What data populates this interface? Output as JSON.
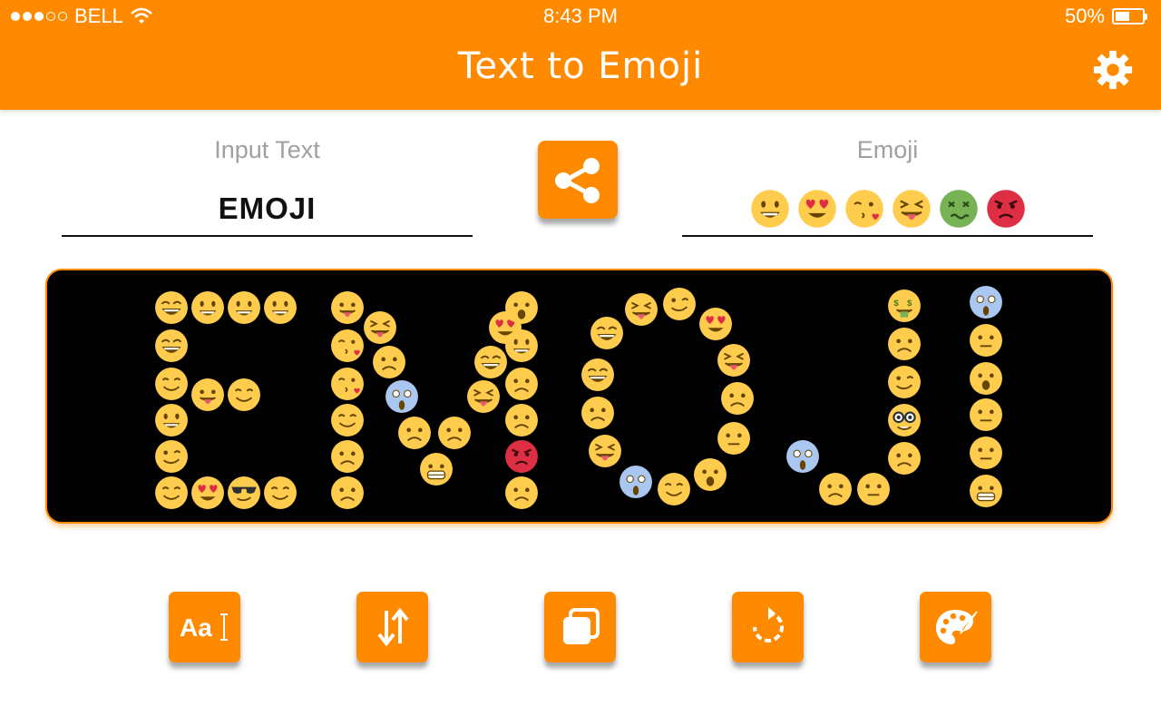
{
  "status_bar": {
    "carrier": "BELL",
    "time": "8:43 PM",
    "battery_percent": "50%",
    "battery_level": 0.5,
    "signal_bars": 3,
    "signal_total": 5
  },
  "nav": {
    "title": "Text to Emoji",
    "settings_icon": "gear-icon"
  },
  "input": {
    "label": "Input Text",
    "value": "EMOJI"
  },
  "emoji_field": {
    "label": "Emoji",
    "faces": [
      "grinning",
      "heart-eyes",
      "kissing-heart",
      "squinting-tongue",
      "nauseated",
      "pouting"
    ]
  },
  "share_icon": "share-icon",
  "toolbar": [
    {
      "name": "font-style-button",
      "icon": "text-format-icon"
    },
    {
      "name": "sort-button",
      "icon": "sort-arrows-icon"
    },
    {
      "name": "copy-button",
      "icon": "copy-icon"
    },
    {
      "name": "reset-button",
      "icon": "rotate-icon"
    },
    {
      "name": "palette-button",
      "icon": "palette-icon"
    }
  ],
  "colors": {
    "accent": "#ff8a00",
    "canvas_bg": "#000000",
    "emoji_yellow": "#ffcc4d"
  }
}
